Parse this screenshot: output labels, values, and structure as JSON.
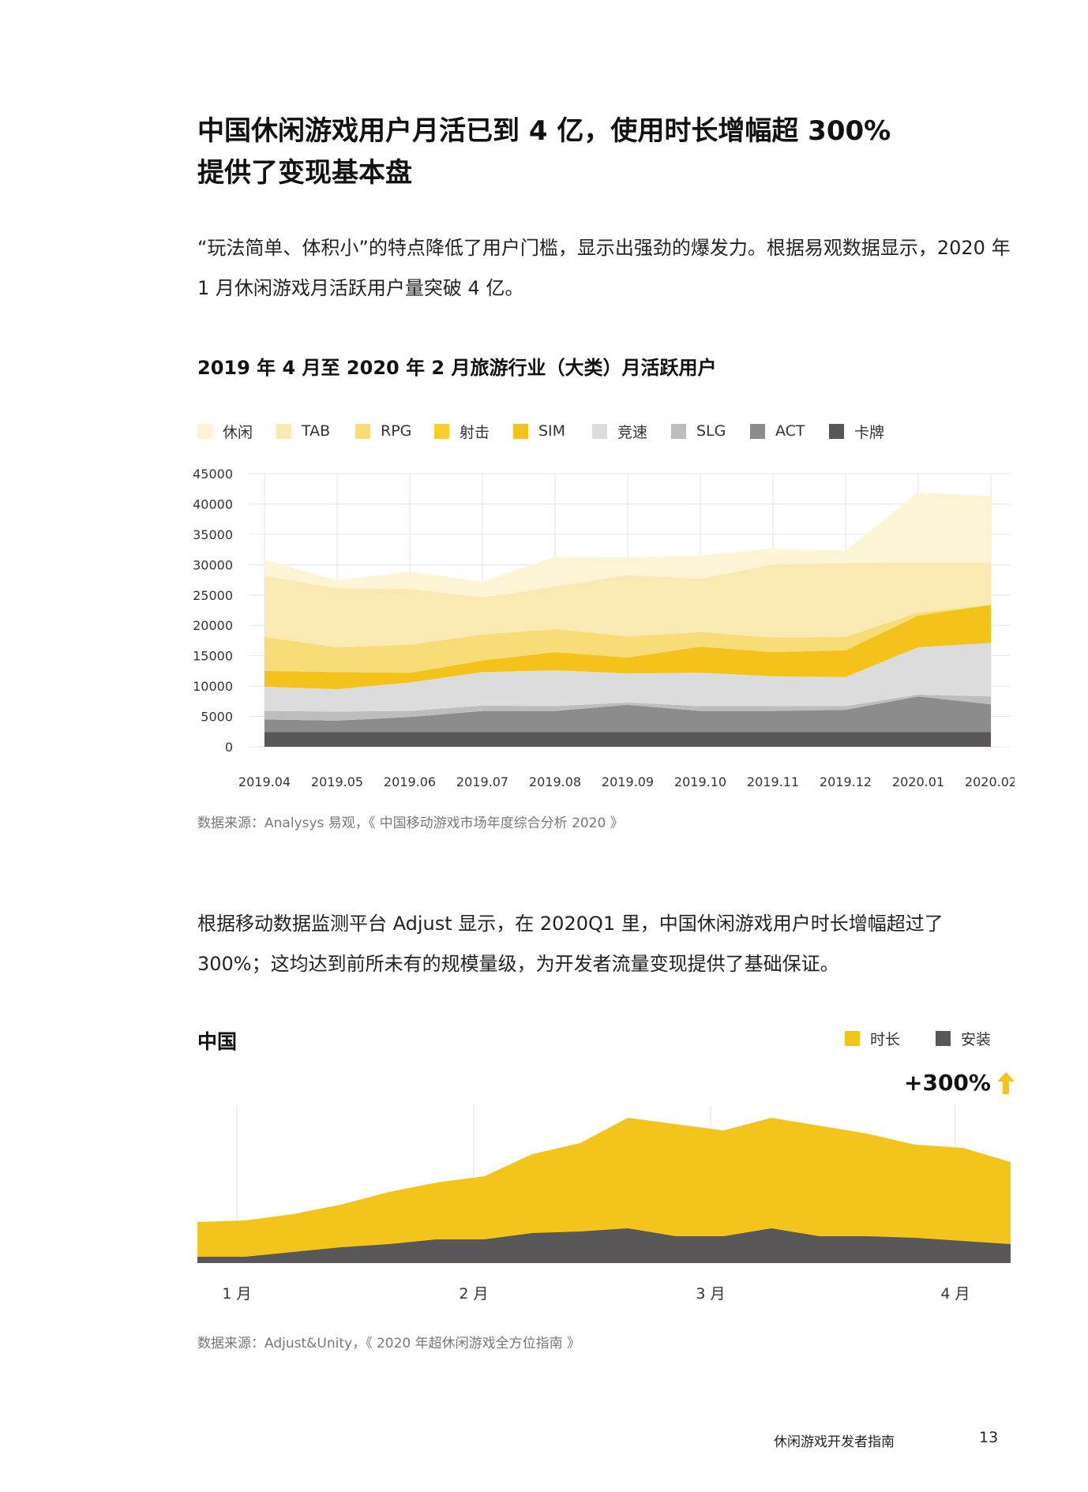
{
  "page": {
    "headline": [
      "中国休闲游戏用户月活已到 4 亿，使用时长增幅超 300%",
      "提供了变现基本盘"
    ],
    "intro": "“玩法简单、体积小”的特点降低了用户门槛，显示出强劲的爆发力。根据易观数据显示，2020 年 1 月休闲游戏月活跃用户量突破 4 亿。",
    "source1": "数据来源：Analysys 易观，《 中国移动游戏市场年度综合分析 2020 》",
    "para2": "根据移动数据监测平台 Adjust 显示，在 2020Q1 里，中国休闲游戏用户时长增幅超过了 300%；这均达到前所未有的规模量级，为开发者流量变现提供了基础保证。",
    "source2": "数据来源：Adjust&Unity，《 2020 年超休闲游戏全方位指南 》",
    "footer_title": "休闲游戏开发者指南",
    "page_number": "13"
  },
  "chart_data": [
    {
      "type": "area",
      "stacked": true,
      "title": "2019 年 4 月至 2020 年 2 月旅游行业（大类）月活跃用户",
      "xlabel": "",
      "ylabel": "",
      "x": [
        "2019.04",
        "2019.05",
        "2019.06",
        "2019.07",
        "2019.08",
        "2019.09",
        "2019.10",
        "2019.11",
        "2019.12",
        "2020.01",
        "2020.02"
      ],
      "ylim": [
        0,
        45000
      ],
      "yticks": [
        0,
        5000,
        10000,
        15000,
        20000,
        25000,
        30000,
        35000,
        40000,
        45000
      ],
      "grid": true,
      "legend_position": "top",
      "series": [
        {
          "name": "卡牌",
          "color": "#595757",
          "values": [
            2400,
            2400,
            2400,
            2400,
            2400,
            2400,
            2400,
            2400,
            2400,
            2400,
            2400
          ]
        },
        {
          "name": "ACT",
          "color": "#8c8c8c",
          "values": [
            2100,
            1900,
            2500,
            3500,
            3500,
            4500,
            3500,
            3500,
            3700,
            5900,
            4600
          ]
        },
        {
          "name": "SLG",
          "color": "#bdbdbd",
          "values": [
            1400,
            1500,
            1000,
            900,
            800,
            400,
            800,
            800,
            600,
            300,
            1300
          ]
        },
        {
          "name": "竞速",
          "color": "#dcdcdc",
          "values": [
            4000,
            3700,
            4700,
            5500,
            5900,
            4800,
            5500,
            4900,
            4800,
            7800,
            8800
          ]
        },
        {
          "name": "SIM",
          "color": "#f3c21b",
          "values": [
            2600,
            2800,
            1600,
            1900,
            3000,
            2600,
            4300,
            4000,
            4400,
            5200,
            6300
          ]
        },
        {
          "name": "射击",
          "color": "#f6cf2e",
          "values": [
            0,
            0,
            0,
            0,
            0,
            0,
            0,
            0,
            0,
            0,
            0
          ]
        },
        {
          "name": "RPG",
          "color": "#f8dc78",
          "values": [
            5600,
            4100,
            4600,
            4300,
            3800,
            3500,
            2400,
            2400,
            2200,
            500,
            0
          ]
        },
        {
          "name": "TAB",
          "color": "#fbe9b3",
          "values": [
            10100,
            9700,
            9200,
            6100,
            7000,
            10100,
            8800,
            12000,
            12200,
            8300,
            7000
          ]
        },
        {
          "name": "休闲",
          "color": "#fdf4d6",
          "values": [
            2600,
            1300,
            2900,
            2600,
            4900,
            2900,
            3800,
            2700,
            2000,
            11500,
            10900
          ]
        }
      ]
    },
    {
      "type": "area",
      "title": "中国",
      "xlabel": "",
      "ylabel": "",
      "x_ticks": [
        "1 月",
        "2 月",
        "3 月",
        "4 月"
      ],
      "annotation": "+300%",
      "grid": true,
      "legend_position": "top-right",
      "series": [
        {
          "name": "时长",
          "color": "#f3c41b",
          "values": [
            26,
            27,
            31,
            37,
            45,
            51,
            55,
            69,
            76,
            92,
            88,
            84,
            92,
            87,
            82,
            75,
            73,
            64
          ]
        },
        {
          "name": "安装",
          "color": "#595757",
          "values": [
            4,
            4,
            7,
            10,
            12,
            15,
            15,
            19,
            20,
            22,
            17,
            17,
            22,
            17,
            17,
            16,
            14,
            12
          ]
        }
      ]
    }
  ]
}
